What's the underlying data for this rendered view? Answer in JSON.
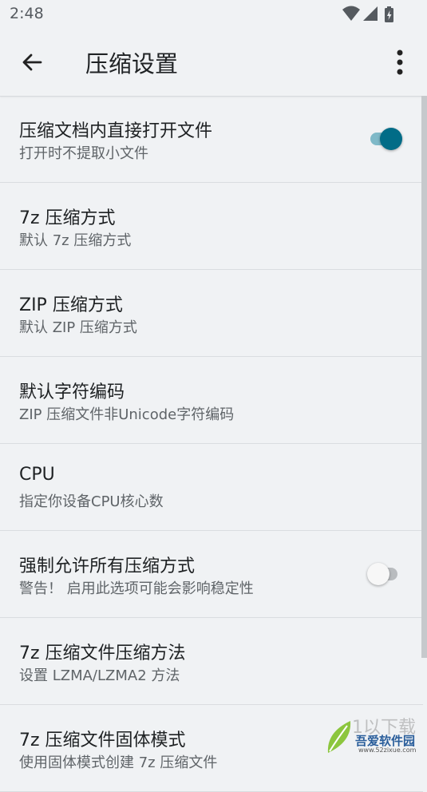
{
  "status_bar": {
    "time": "2:48",
    "icons": [
      "wifi-icon",
      "signal-icon",
      "battery-icon"
    ]
  },
  "app_bar": {
    "title": "压缩设置",
    "back_icon": "arrow-left-icon",
    "menu_icon": "more-vert-icon"
  },
  "settings": [
    {
      "title": "压缩文档内直接打开文件",
      "subtitle": "打开时不提取小文件",
      "toggle": true,
      "toggle_on": true
    },
    {
      "title": "7z 压缩方式",
      "subtitle": "默认 7z 压缩方式"
    },
    {
      "title": "ZIP 压缩方式",
      "subtitle": "默认 ZIP 压缩方式"
    },
    {
      "title": "默认字符编码",
      "subtitle": "ZIP 压缩文件非Unicode字符编码"
    },
    {
      "title": "CPU",
      "subtitle": "指定你设备CPU核心数"
    },
    {
      "title": "强制允许所有压缩方式",
      "subtitle": "警告！ 启用此选项可能会影响稳定性",
      "toggle": true,
      "toggle_on": false
    },
    {
      "title": "7z 压缩文件压缩方法",
      "subtitle": "设置 LZMA/LZMA2 方法"
    },
    {
      "title": "7z 压缩文件固体模式",
      "subtitle": "使用固体模式创建 7z 压缩文件"
    }
  ],
  "watermark": {
    "text": "吾爱软件园",
    "url": "www.52zixue.com",
    "overlay": "1以下载"
  },
  "colors": {
    "accent": "#016c87",
    "accent_track": "#7fb9c8",
    "background": "#f0f2f4",
    "title_text": "#1e2123",
    "subtitle_text": "#5f6468"
  }
}
